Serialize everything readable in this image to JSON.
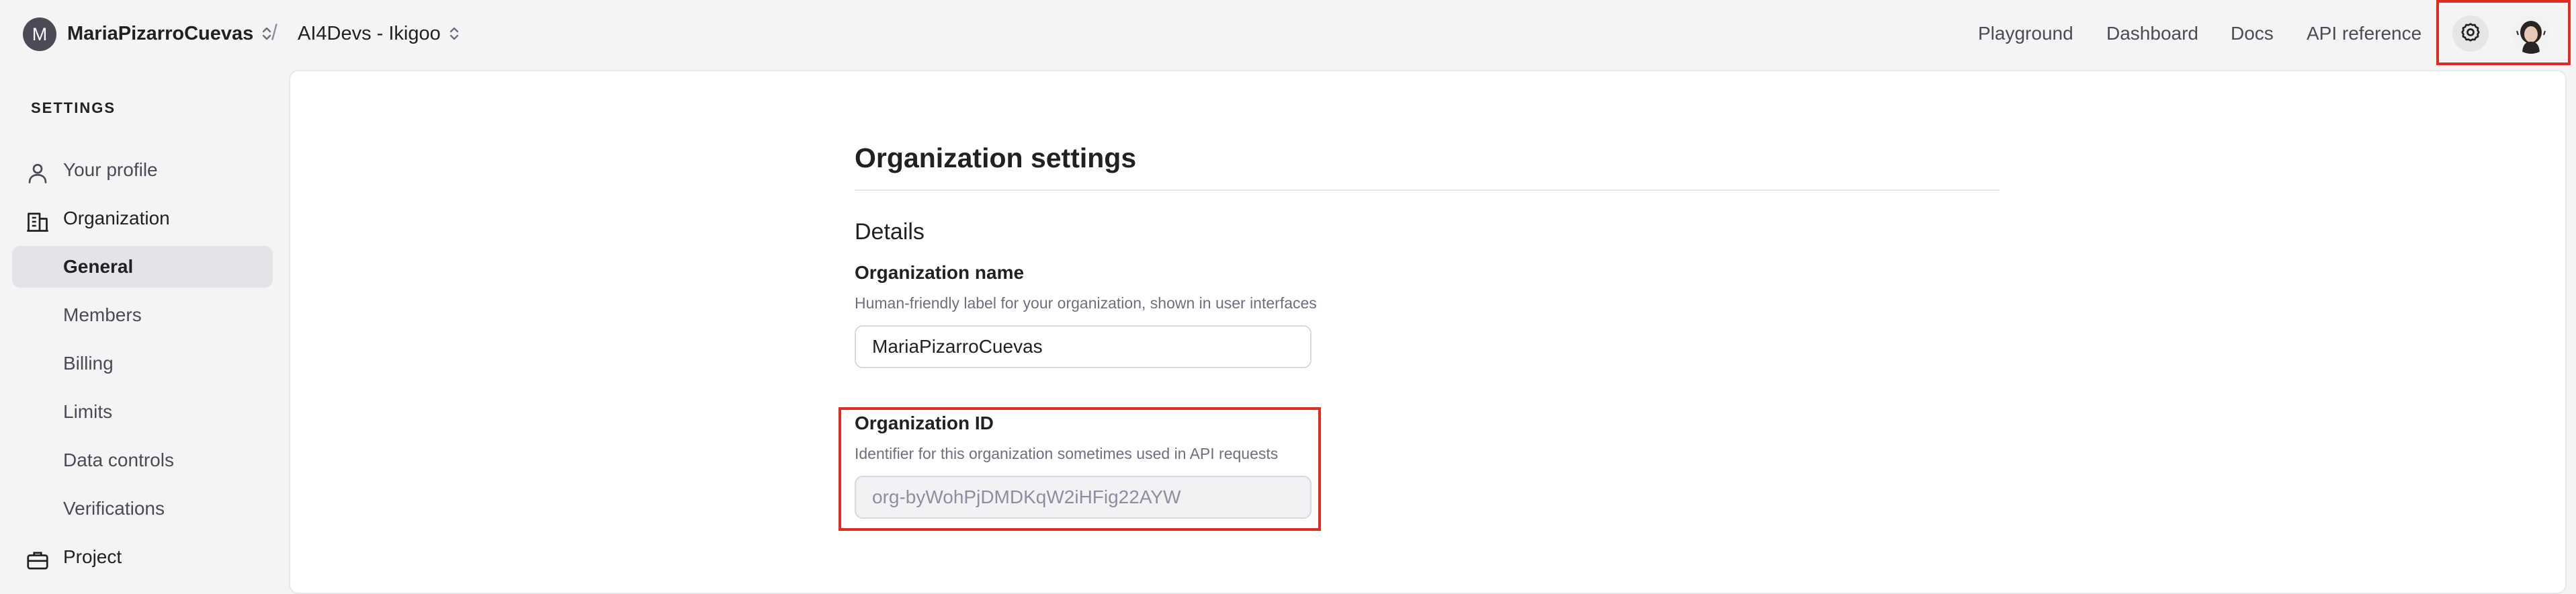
{
  "header": {
    "org_initial": "M",
    "org_name": "MariaPizarroCuevas",
    "separator": "/",
    "project_name": "AI4Devs - Ikigoo",
    "nav": [
      {
        "label": "Playground"
      },
      {
        "label": "Dashboard"
      },
      {
        "label": "Docs"
      },
      {
        "label": "API reference"
      }
    ],
    "icons": {
      "settings": "gear-icon",
      "profile": "user-avatar"
    }
  },
  "sidebar": {
    "heading": "SETTINGS",
    "items": [
      {
        "label": "Your profile",
        "icon": "person-icon"
      },
      {
        "label": "Organization",
        "icon": "building-icon"
      },
      {
        "label": "General"
      },
      {
        "label": "Members"
      },
      {
        "label": "Billing"
      },
      {
        "label": "Limits"
      },
      {
        "label": "Data controls"
      },
      {
        "label": "Verifications"
      },
      {
        "label": "Project",
        "icon": "briefcase-icon"
      }
    ],
    "active": "General"
  },
  "main": {
    "title": "Organization settings",
    "section": "Details",
    "org_name_field": {
      "label": "Organization name",
      "help": "Human-friendly label for your organization, shown in user interfaces",
      "value": "MariaPizarroCuevas"
    },
    "org_id_field": {
      "label": "Organization ID",
      "help": "Identifier for this organization sometimes used in API requests",
      "value": "org-byWohPjDMDKqW2iHFig22AYW"
    }
  },
  "colors": {
    "highlight": "#e02b20",
    "active_bg": "#e4e4e8",
    "page_bg": "#f4f4f4"
  }
}
